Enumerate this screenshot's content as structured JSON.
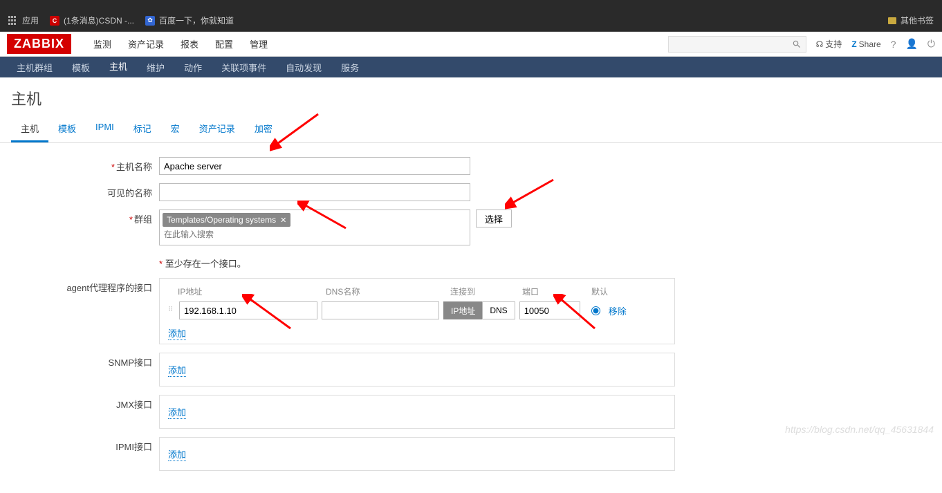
{
  "browser": {
    "apps_label": "应用",
    "bookmark1": "(1条消息)CSDN -...",
    "bookmark2": "百度一下，你就知道",
    "other_bookmarks": "其他书签"
  },
  "logo": "ZABBIX",
  "topnav": [
    "监测",
    "资产记录",
    "报表",
    "配置",
    "管理"
  ],
  "topnav_active": 3,
  "support": "支持",
  "share": "Share",
  "help": "?",
  "subnav": [
    "主机群组",
    "模板",
    "主机",
    "维护",
    "动作",
    "关联项事件",
    "自动发现",
    "服务"
  ],
  "subnav_active": 2,
  "page_title": "主机",
  "tabs": [
    "主机",
    "模板",
    "IPMI",
    "标记",
    "宏",
    "资产记录",
    "加密"
  ],
  "tabs_active": 0,
  "form": {
    "host_name_label": "主机名称",
    "host_name_value": "Apache server",
    "visible_name_label": "可见的名称",
    "visible_name_value": "",
    "groups_label": "群组",
    "group_tag": "Templates/Operating systems",
    "group_search_placeholder": "在此输入搜索",
    "select_btn": "选择",
    "note": "至少存在一个接口。",
    "agent_label": "agent代理程序的接口",
    "snmp_label": "SNMP接口",
    "jmx_label": "JMX接口",
    "ipmi_label": "IPMI接口",
    "iface_headers": {
      "ip": "IP地址",
      "dns": "DNS名称",
      "connect": "连接到",
      "port": "端口",
      "default": "默认"
    },
    "ip_value": "192.168.1.10",
    "dns_value": "",
    "port_value": "10050",
    "toggle_ip": "IP地址",
    "toggle_dns": "DNS",
    "remove": "移除",
    "add": "添加"
  },
  "watermark": "https://blog.csdn.net/qq_45631844"
}
